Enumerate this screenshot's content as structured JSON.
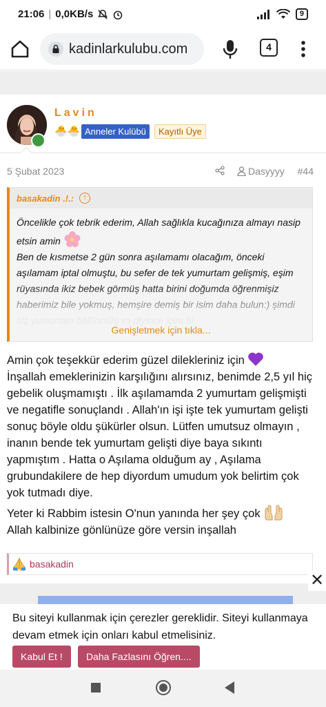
{
  "status_bar": {
    "time": "21:06",
    "speed": "0,0KB/s",
    "battery": "9"
  },
  "browser": {
    "url": "kadinlarkulubu.com",
    "tab_count": "4"
  },
  "post": {
    "username": "Lavin",
    "chicks": "🐣🐣",
    "badge_group": "Anneler Kulübü",
    "badge_status": "Kayıtlı Üye",
    "date": "5 Şubat 2023",
    "author": "Dasyyyy",
    "number": "#44",
    "quote": {
      "author": "basakadin .!.:",
      "line1": "Öncelikle çok tebrik ederim, Allah sağlıkla kucağınıza almayı nasip etsin amin",
      "line2": "Ben de kısmetse 2 gün sonra aşılamamı olacağım, önceki aşılamam iptal olmuştu, bu sefer de tek yumurtam gelişmiş, eşim rüyasında ikiz bebek görmüş hatta birini doğumda öğrenmişiz haberimiz bile yokmuş, hemşire demiş bir isim daha bulun:) şimdi siz yumurtam bölünmüş vs diyince içim bi",
      "expand_label": "Genişletmek için tıkla..."
    },
    "message": {
      "p1": "Amin çok teşekkür ederim güzel dilekleriniz için",
      "p2": "İnşallah emeklerinizin karşılığını alırsınız, benimde 2,5 yıl hiç gebelik oluşmamıştı . İlk aşılamamda 2 yumurtam gelişmişti ve negatifle sonuçlandı . Allah'ın işi işte tek yumurtam gelişti sonuç böyle oldu şükürler olsun. Lütfen umutsuz olmayın , inanın bende tek yumurtam gelişti diye baya sıkıntı yapmıştım . Hatta o Aşılama olduğum ay , Aşılama grubundakilere de hep diyordum umudum yok belirtim çok yok tutmadı diye.",
      "p3": "Yeter ki Rabbim istesin O'nun yanında her şey çok",
      "p4": "Allah kalbinize gönlünüze göre versin inşallah"
    },
    "reaction_user": "basakadin"
  },
  "cookie": {
    "text": "Bu siteyi kullanmak için çerezler gereklidir. Siteyi kullanmaya devam etmek için onları kabul etmelisiniz.",
    "accept_label": "Kabul Et !",
    "more_label": "Daha Fazlasını Öğren...."
  },
  "colors": {
    "accent": "#e08a1c",
    "group_badge": "#3660c8",
    "cookie_button": "#b84a66"
  },
  "icons": [
    "silent-icon",
    "alarm-icon",
    "signal-icon",
    "wifi-icon",
    "battery-icon",
    "home-icon",
    "lock-icon",
    "mic-icon",
    "menu-icon",
    "share-icon",
    "user-icon",
    "arrow-up-icon",
    "flower-emoji",
    "purple-heart-emoji",
    "raising-hands-emoji",
    "pray-emoji",
    "close-icon"
  ]
}
